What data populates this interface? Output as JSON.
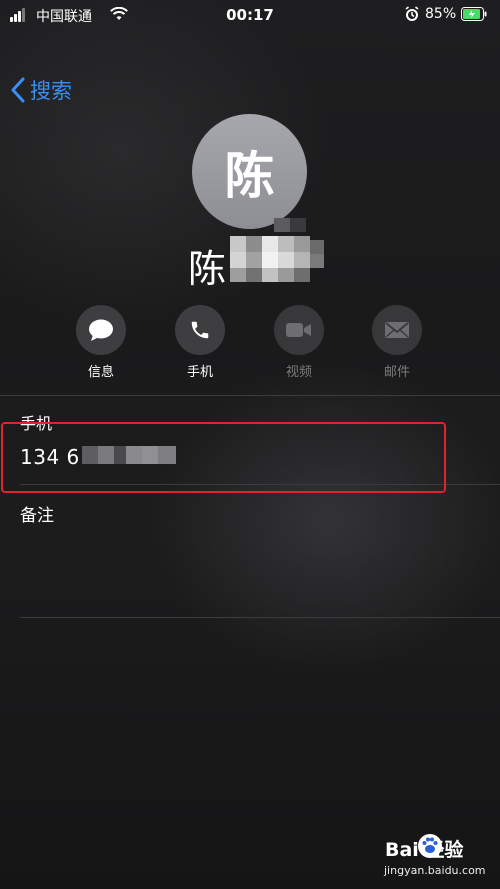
{
  "status_bar": {
    "carrier": "中国联通",
    "time": "00:17",
    "battery": "85%"
  },
  "nav": {
    "back_label": "搜索"
  },
  "contact": {
    "avatar_initial": "陈",
    "name_visible": "陈"
  },
  "actions": [
    {
      "label": "信息",
      "icon": "message-icon",
      "enabled": true
    },
    {
      "label": "手机",
      "icon": "phone-icon",
      "enabled": true
    },
    {
      "label": "视频",
      "icon": "video-icon",
      "enabled": false
    },
    {
      "label": "邮件",
      "icon": "mail-icon",
      "enabled": false
    }
  ],
  "phone_field": {
    "label": "手机",
    "value_visible": "134 6"
  },
  "notes_field": {
    "label": "备注"
  },
  "watermark": {
    "brand": "Bai  经验",
    "url": "jingyan.baidu.com"
  },
  "colors": {
    "accent": "#3a8ef6",
    "highlight": "#e0232f"
  }
}
